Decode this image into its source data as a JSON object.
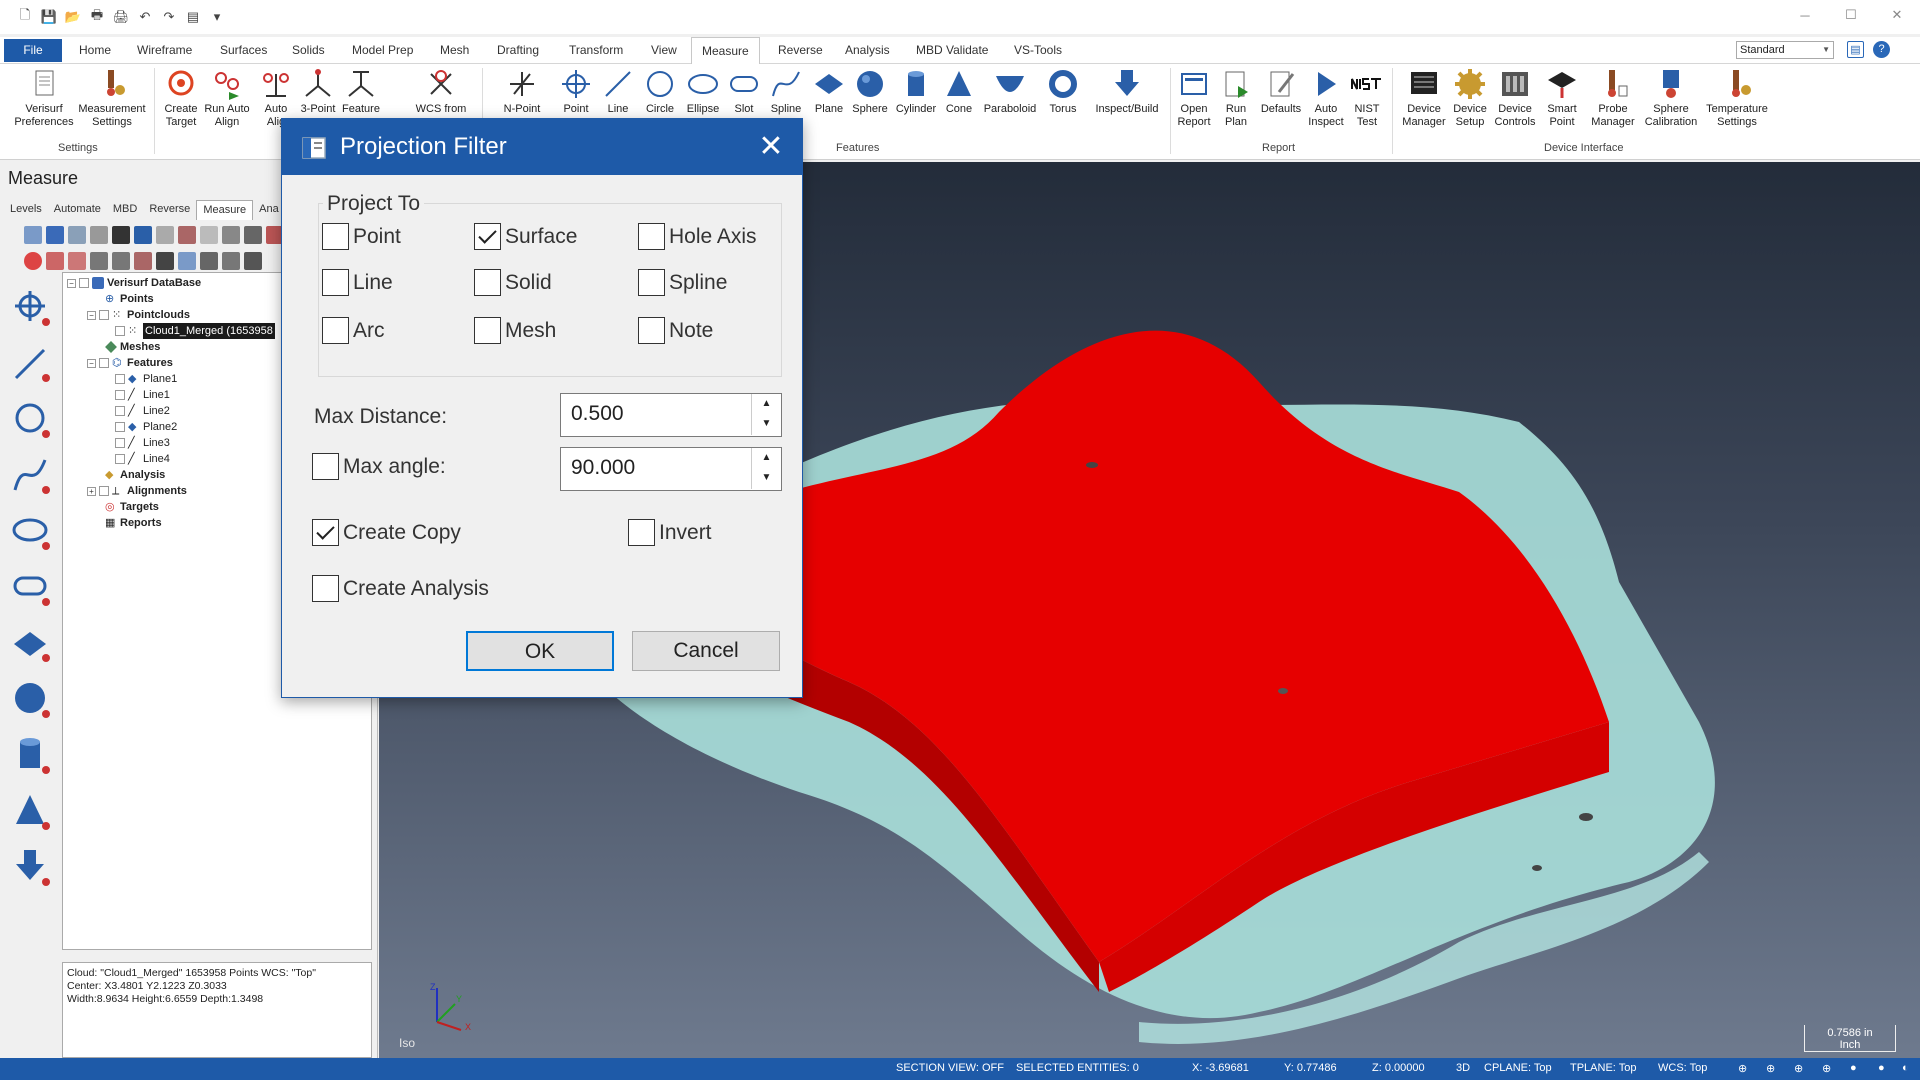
{
  "app": {
    "quick_access_icons": [
      "new-file-icon",
      "save-icon",
      "open-icon",
      "print-icon",
      "print-preview-icon",
      "undo-icon",
      "redo-icon",
      "properties-icon",
      "customize-icon"
    ]
  },
  "ribbon_tabs": [
    "File",
    "Home",
    "Wireframe",
    "Surfaces",
    "Solids",
    "Model Prep",
    "Mesh",
    "Drafting",
    "Transform",
    "View",
    "Measure",
    "Reverse",
    "Analysis",
    "MBD Validate",
    "VS-Tools"
  ],
  "active_tab": "Measure",
  "style_select": "Standard",
  "ribbon": {
    "settings": {
      "label": "Settings",
      "buttons": [
        "Verisurf\nPreferences",
        "Measurement\nSettings",
        "Create\nTarget",
        "Run Auto\nAlign",
        "Auto\nAlig"
      ]
    },
    "wcs": {
      "buttons": [
        "3-Point",
        "Feature",
        "WCS from"
      ]
    },
    "features": {
      "label": "Features",
      "buttons": [
        "N-Point",
        "Point",
        "Line",
        "Circle",
        "Ellipse",
        "Slot",
        "Spline",
        "Plane",
        "Sphere",
        "Cylinder",
        "Cone",
        "Paraboloid",
        "Torus",
        "Inspect/Build"
      ]
    },
    "report": {
      "label": "Report",
      "buttons": [
        "Open\nReport",
        "Run\nPlan",
        "Defaults",
        "Auto\nInspect",
        "NIST\nTest"
      ]
    },
    "device": {
      "label": "Device Interface",
      "buttons": [
        "Device\nManager",
        "Device\nSetup",
        "Device\nControls",
        "Smart\nPoint",
        "Probe\nManager",
        "Sphere\nCalibration",
        "Temperature\nSettings"
      ]
    }
  },
  "left_panel": {
    "title": "Measure",
    "tabs": [
      "Levels",
      "Automate",
      "MBD",
      "Reverse",
      "Measure",
      "Ana"
    ],
    "active_tab": "Measure",
    "tree": [
      {
        "label": "Verisurf DataBase",
        "bold": true
      },
      {
        "label": "Points",
        "bold": true
      },
      {
        "label": "Pointclouds",
        "bold": true
      },
      {
        "label": "Cloud1_Merged (1653958",
        "bold": false,
        "selected": true
      },
      {
        "label": "Meshes",
        "bold": true
      },
      {
        "label": "Features",
        "bold": true
      },
      {
        "label": "Plane1",
        "bold": false
      },
      {
        "label": "Line1",
        "bold": false
      },
      {
        "label": "Line2",
        "bold": false
      },
      {
        "label": "Plane2",
        "bold": false
      },
      {
        "label": "Line3",
        "bold": false
      },
      {
        "label": "Line4",
        "bold": false
      },
      {
        "label": "Analysis",
        "bold": true
      },
      {
        "label": "Alignments",
        "bold": true
      },
      {
        "label": "Targets",
        "bold": true
      },
      {
        "label": "Reports",
        "bold": true
      }
    ],
    "info": {
      "line1": "Cloud: \"Cloud1_Merged\" 1653958 Points  WCS: \"Top\"",
      "line2": "Center: X3.4801 Y2.1223 Z0.3033",
      "line3": "Width:8.9634 Height:6.6559 Depth:1.3498"
    }
  },
  "viewport": {
    "view_label": "Iso",
    "scale_value": "0.7586 in",
    "scale_unit": "Inch",
    "axis_labels": [
      "Z",
      "Y",
      "X"
    ]
  },
  "dialog": {
    "title": "Projection Filter",
    "group_label": "Project To",
    "options": [
      {
        "label": "Point",
        "checked": false
      },
      {
        "label": "Surface",
        "checked": true
      },
      {
        "label": "Hole Axis",
        "checked": false
      },
      {
        "label": "Line",
        "checked": false
      },
      {
        "label": "Solid",
        "checked": false
      },
      {
        "label": "Spline",
        "checked": false
      },
      {
        "label": "Arc",
        "checked": false
      },
      {
        "label": "Mesh",
        "checked": false
      },
      {
        "label": "Note",
        "checked": false
      }
    ],
    "max_distance_label": "Max Distance:",
    "max_distance_value": "0.500",
    "max_angle_label": "Max angle:",
    "max_angle_checked": false,
    "max_angle_value": "90.000",
    "create_copy_label": "Create Copy",
    "create_copy_checked": true,
    "invert_label": "Invert",
    "invert_checked": false,
    "create_analysis_label": "Create Analysis",
    "create_analysis_checked": false,
    "ok_label": "OK",
    "cancel_label": "Cancel"
  },
  "status_bar": {
    "section_view": "SECTION VIEW: OFF",
    "selected": "SELECTED ENTITIES: 0",
    "x": "X:   -3.69681",
    "y": "Y:   0.77486",
    "z": "Z:   0.00000",
    "mode": "3D",
    "cplane": "CPLANE: Top",
    "tplane": "TPLANE: Top",
    "wcs": "WCS: Top"
  },
  "colors": {
    "accent": "#1e5aa8",
    "part_red": "#e60000",
    "cloud_cyan": "#a7dcd8"
  }
}
